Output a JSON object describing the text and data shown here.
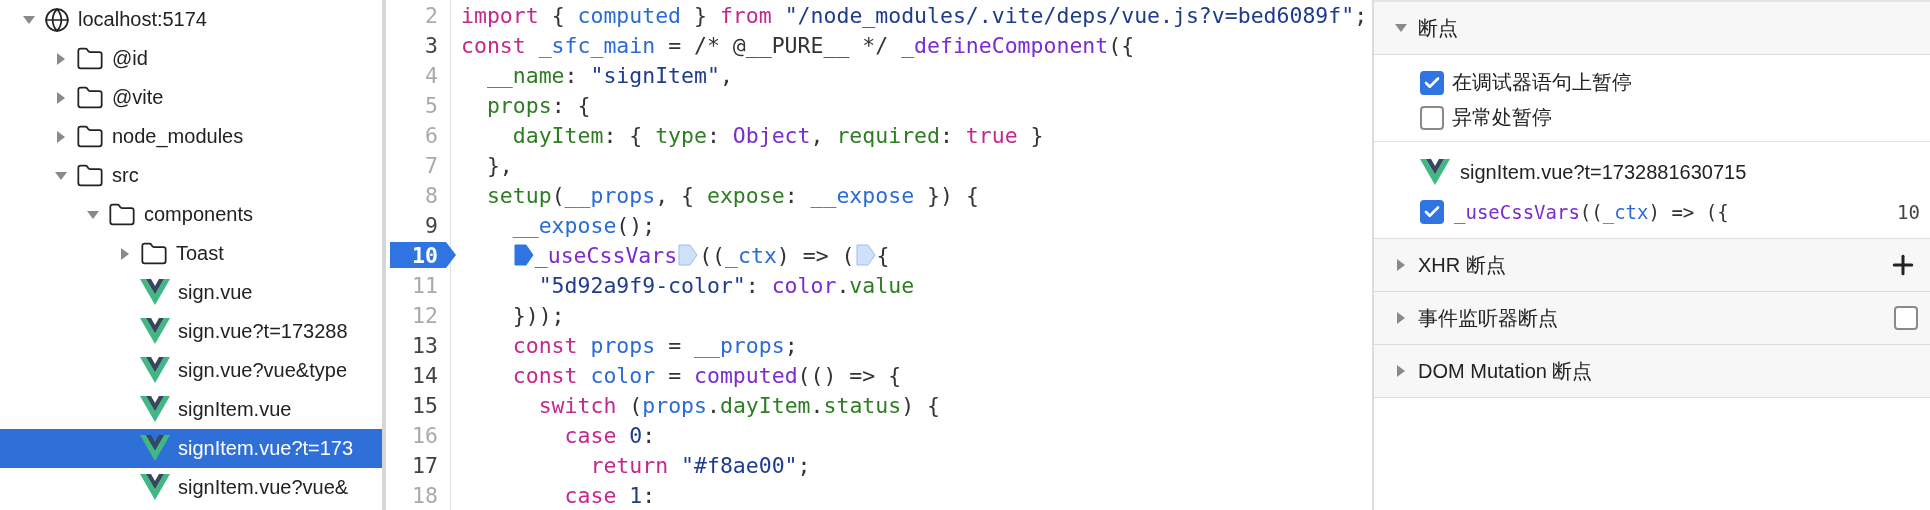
{
  "file_tree": [
    {
      "label": "localhost:5174",
      "kind": "host",
      "expanded": true,
      "selected": false,
      "children": [
        {
          "label": "@id",
          "kind": "folder",
          "expanded": false,
          "selected": false
        },
        {
          "label": "@vite",
          "kind": "folder",
          "expanded": false,
          "selected": false
        },
        {
          "label": "node_modules",
          "kind": "folder",
          "expanded": false,
          "selected": false
        },
        {
          "label": "src",
          "kind": "folder",
          "expanded": true,
          "selected": false,
          "children": [
            {
              "label": "components",
              "kind": "folder",
              "expanded": true,
              "selected": false,
              "children": [
                {
                  "label": "Toast",
                  "kind": "folder",
                  "expanded": false,
                  "selected": false
                },
                {
                  "label": "sign.vue",
                  "kind": "file",
                  "selected": false
                },
                {
                  "label": "sign.vue?t=173288",
                  "kind": "file",
                  "selected": false
                },
                {
                  "label": "sign.vue?vue&type",
                  "kind": "file",
                  "selected": false
                },
                {
                  "label": "signItem.vue",
                  "kind": "file",
                  "selected": false
                },
                {
                  "label": "signItem.vue?t=173",
                  "kind": "file",
                  "selected": true
                },
                {
                  "label": "signItem.vue?vue&",
                  "kind": "file",
                  "selected": false
                }
              ]
            }
          ]
        }
      ]
    }
  ],
  "editor": {
    "lines": [
      {
        "number": "2",
        "breakable": false,
        "breakpoint": false,
        "tokens": [
          {
            "text": "import",
            "kind": "keyword"
          },
          {
            "text": " { ",
            "kind": "plain"
          },
          {
            "text": "computed",
            "kind": "variable"
          },
          {
            "text": " } ",
            "kind": "plain"
          },
          {
            "text": "from ",
            "kind": "keyword"
          },
          {
            "text": "\"/node_modules/.vite/deps/vue.js?v=bed6089f\"",
            "kind": "string"
          },
          {
            "text": ";",
            "kind": "plain"
          }
        ]
      },
      {
        "number": "3",
        "breakable": true,
        "breakpoint": false,
        "tokens": [
          {
            "text": "const ",
            "kind": "keyword"
          },
          {
            "text": "_sfc_main",
            "kind": "variable"
          },
          {
            "text": " = /* @__PURE__ */ ",
            "kind": "plain"
          },
          {
            "text": "_defineComponent",
            "kind": "function"
          },
          {
            "text": "({",
            "kind": "plain"
          }
        ]
      },
      {
        "number": "4",
        "breakable": false,
        "breakpoint": false,
        "tokens": [
          {
            "text": "  __name",
            "kind": "property"
          },
          {
            "text": ": ",
            "kind": "plain"
          },
          {
            "text": "\"signItem\"",
            "kind": "string"
          },
          {
            "text": ",",
            "kind": "plain"
          }
        ]
      },
      {
        "number": "5",
        "breakable": false,
        "breakpoint": false,
        "tokens": [
          {
            "text": "  props",
            "kind": "property"
          },
          {
            "text": ": {",
            "kind": "plain"
          }
        ]
      },
      {
        "number": "6",
        "breakable": false,
        "breakpoint": false,
        "tokens": [
          {
            "text": "    dayItem",
            "kind": "property"
          },
          {
            "text": ": { ",
            "kind": "plain"
          },
          {
            "text": "type",
            "kind": "property"
          },
          {
            "text": ": ",
            "kind": "plain"
          },
          {
            "text": "Object",
            "kind": "function"
          },
          {
            "text": ", ",
            "kind": "plain"
          },
          {
            "text": "required",
            "kind": "property"
          },
          {
            "text": ": ",
            "kind": "plain"
          },
          {
            "text": "true",
            "kind": "keyword"
          },
          {
            "text": " }",
            "kind": "plain"
          }
        ]
      },
      {
        "number": "7",
        "breakable": false,
        "breakpoint": false,
        "tokens": [
          {
            "text": "  },",
            "kind": "plain"
          }
        ]
      },
      {
        "number": "8",
        "breakable": false,
        "breakpoint": false,
        "tokens": [
          {
            "text": "  setup",
            "kind": "property"
          },
          {
            "text": "(",
            "kind": "plain"
          },
          {
            "text": "__props",
            "kind": "variable"
          },
          {
            "text": ", { ",
            "kind": "plain"
          },
          {
            "text": "expose",
            "kind": "property"
          },
          {
            "text": ": ",
            "kind": "plain"
          },
          {
            "text": "__expose",
            "kind": "variable"
          },
          {
            "text": " }) {",
            "kind": "plain"
          }
        ]
      },
      {
        "number": "9",
        "breakable": true,
        "breakpoint": false,
        "tokens": [
          {
            "text": "    __expose",
            "kind": "variable"
          },
          {
            "text": "();",
            "kind": "plain"
          }
        ]
      },
      {
        "number": "10",
        "breakable": true,
        "breakpoint": true,
        "tokens": [
          {
            "text": "    _useCssVars",
            "kind": "function",
            "marker": {
              "active": true
            }
          },
          {
            "text": "((",
            "kind": "plain",
            "marker": {
              "active": false
            }
          },
          {
            "text": "_ctx",
            "kind": "variable"
          },
          {
            "text": ") => (",
            "kind": "plain"
          },
          {
            "text": "{",
            "kind": "plain",
            "marker": {
              "active": false
            }
          }
        ]
      },
      {
        "number": "11",
        "breakable": false,
        "breakpoint": false,
        "tokens": [
          {
            "text": "      \"5d92a9f9-color\"",
            "kind": "string"
          },
          {
            "text": ": ",
            "kind": "plain"
          },
          {
            "text": "color",
            "kind": "function"
          },
          {
            "text": ".",
            "kind": "plain"
          },
          {
            "text": "value",
            "kind": "property"
          }
        ]
      },
      {
        "number": "12",
        "breakable": false,
        "breakpoint": false,
        "tokens": [
          {
            "text": "    }));",
            "kind": "plain"
          }
        ]
      },
      {
        "number": "13",
        "breakable": true,
        "breakpoint": false,
        "tokens": [
          {
            "text": "    const ",
            "kind": "keyword"
          },
          {
            "text": "props",
            "kind": "variable"
          },
          {
            "text": " = ",
            "kind": "plain"
          },
          {
            "text": "__props",
            "kind": "variable"
          },
          {
            "text": ";",
            "kind": "plain"
          }
        ]
      },
      {
        "number": "14",
        "breakable": true,
        "breakpoint": false,
        "tokens": [
          {
            "text": "    const ",
            "kind": "keyword"
          },
          {
            "text": "color",
            "kind": "variable"
          },
          {
            "text": " = ",
            "kind": "plain"
          },
          {
            "text": "computed",
            "kind": "function"
          },
          {
            "text": "(() => {",
            "kind": "plain"
          }
        ]
      },
      {
        "number": "15",
        "breakable": true,
        "breakpoint": false,
        "tokens": [
          {
            "text": "      switch",
            "kind": "keyword"
          },
          {
            "text": " (",
            "kind": "plain"
          },
          {
            "text": "props",
            "kind": "variable"
          },
          {
            "text": ".",
            "kind": "plain"
          },
          {
            "text": "dayItem",
            "kind": "property"
          },
          {
            "text": ".",
            "kind": "plain"
          },
          {
            "text": "status",
            "kind": "property"
          },
          {
            "text": ") {",
            "kind": "plain"
          }
        ]
      },
      {
        "number": "16",
        "breakable": false,
        "breakpoint": false,
        "tokens": [
          {
            "text": "        case ",
            "kind": "keyword"
          },
          {
            "text": "0",
            "kind": "number"
          },
          {
            "text": ":",
            "kind": "plain"
          }
        ]
      },
      {
        "number": "17",
        "breakable": true,
        "breakpoint": false,
        "tokens": [
          {
            "text": "          return ",
            "kind": "keyword"
          },
          {
            "text": "\"#f8ae00\"",
            "kind": "string"
          },
          {
            "text": ";",
            "kind": "plain"
          }
        ]
      },
      {
        "number": "18",
        "breakable": false,
        "breakpoint": false,
        "tokens": [
          {
            "text": "        case ",
            "kind": "keyword"
          },
          {
            "text": "1",
            "kind": "number"
          },
          {
            "text": ":",
            "kind": "plain"
          }
        ]
      }
    ]
  },
  "breakpoints_panel": {
    "sections": [
      {
        "title": "断点",
        "expanded": true,
        "options": [
          {
            "label": "在调试器语句上暂停",
            "checked": true
          },
          {
            "label": "异常处暂停",
            "checked": false
          }
        ],
        "breakpoints": [
          {
            "file": "signItem.vue?t=1732881630715",
            "checked": true,
            "line": "10",
            "tokens": [
              {
                "text": "_useCssVars",
                "kind": "function"
              },
              {
                "text": "((",
                "kind": "plain"
              },
              {
                "text": "_ctx",
                "kind": "variable"
              },
              {
                "text": ") => ({",
                "kind": "plain"
              }
            ]
          }
        ]
      },
      {
        "title": "XHR 断点",
        "expanded": false,
        "add_button": true
      },
      {
        "title": "事件监听器断点",
        "expanded": false,
        "checkbox": {
          "checked": false
        }
      },
      {
        "title": "DOM Mutation 断点",
        "expanded": false
      }
    ]
  }
}
